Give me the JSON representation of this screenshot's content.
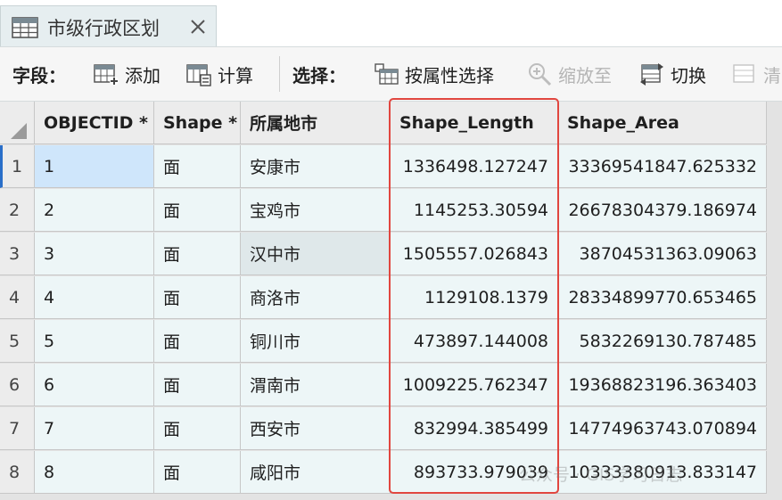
{
  "tab": {
    "title": "市级行政区划"
  },
  "toolbar": {
    "field_label": "字段：",
    "add": "添加",
    "calculate": "计算",
    "selection_label": "选择：",
    "select_by_attr": "按属性选择",
    "zoom_to": "缩放至",
    "switch": "切换",
    "clear": "清"
  },
  "table": {
    "columns": [
      "OBJECTID *",
      "Shape *",
      "所属地市",
      "Shape_Length",
      "Shape_Area"
    ],
    "rows": [
      {
        "idx": "1",
        "objectid": "1",
        "shape": "面",
        "city": "安康市",
        "length": "1336498.127247",
        "area": "33369541847.625332"
      },
      {
        "idx": "2",
        "objectid": "2",
        "shape": "面",
        "city": "宝鸡市",
        "length": "1145253.30594",
        "area": "26678304379.186974"
      },
      {
        "idx": "3",
        "objectid": "3",
        "shape": "面",
        "city": "汉中市",
        "length": "1505557.026843",
        "area": "38704531363.09063"
      },
      {
        "idx": "4",
        "objectid": "4",
        "shape": "面",
        "city": "商洛市",
        "length": "1129108.1379",
        "area": "28334899770.653465"
      },
      {
        "idx": "5",
        "objectid": "5",
        "shape": "面",
        "city": "铜川市",
        "length": "473897.144008",
        "area": "5832269130.787485"
      },
      {
        "idx": "6",
        "objectid": "6",
        "shape": "面",
        "city": "渭南市",
        "length": "1009225.762347",
        "area": "19368823196.363403"
      },
      {
        "idx": "7",
        "objectid": "7",
        "shape": "面",
        "city": "西安市",
        "length": "832994.385499",
        "area": "14774963743.070894"
      },
      {
        "idx": "8",
        "objectid": "8",
        "shape": "面",
        "city": "咸阳市",
        "length": "893733.979039",
        "area": "10333380913.833147"
      }
    ]
  },
  "watermark": "公众号 · GIS学习日志",
  "colors": {
    "highlight": "#e1463f",
    "selected": "#cfe6fb",
    "row": "#edf6f7",
    "accent": "#2a6fc9"
  }
}
